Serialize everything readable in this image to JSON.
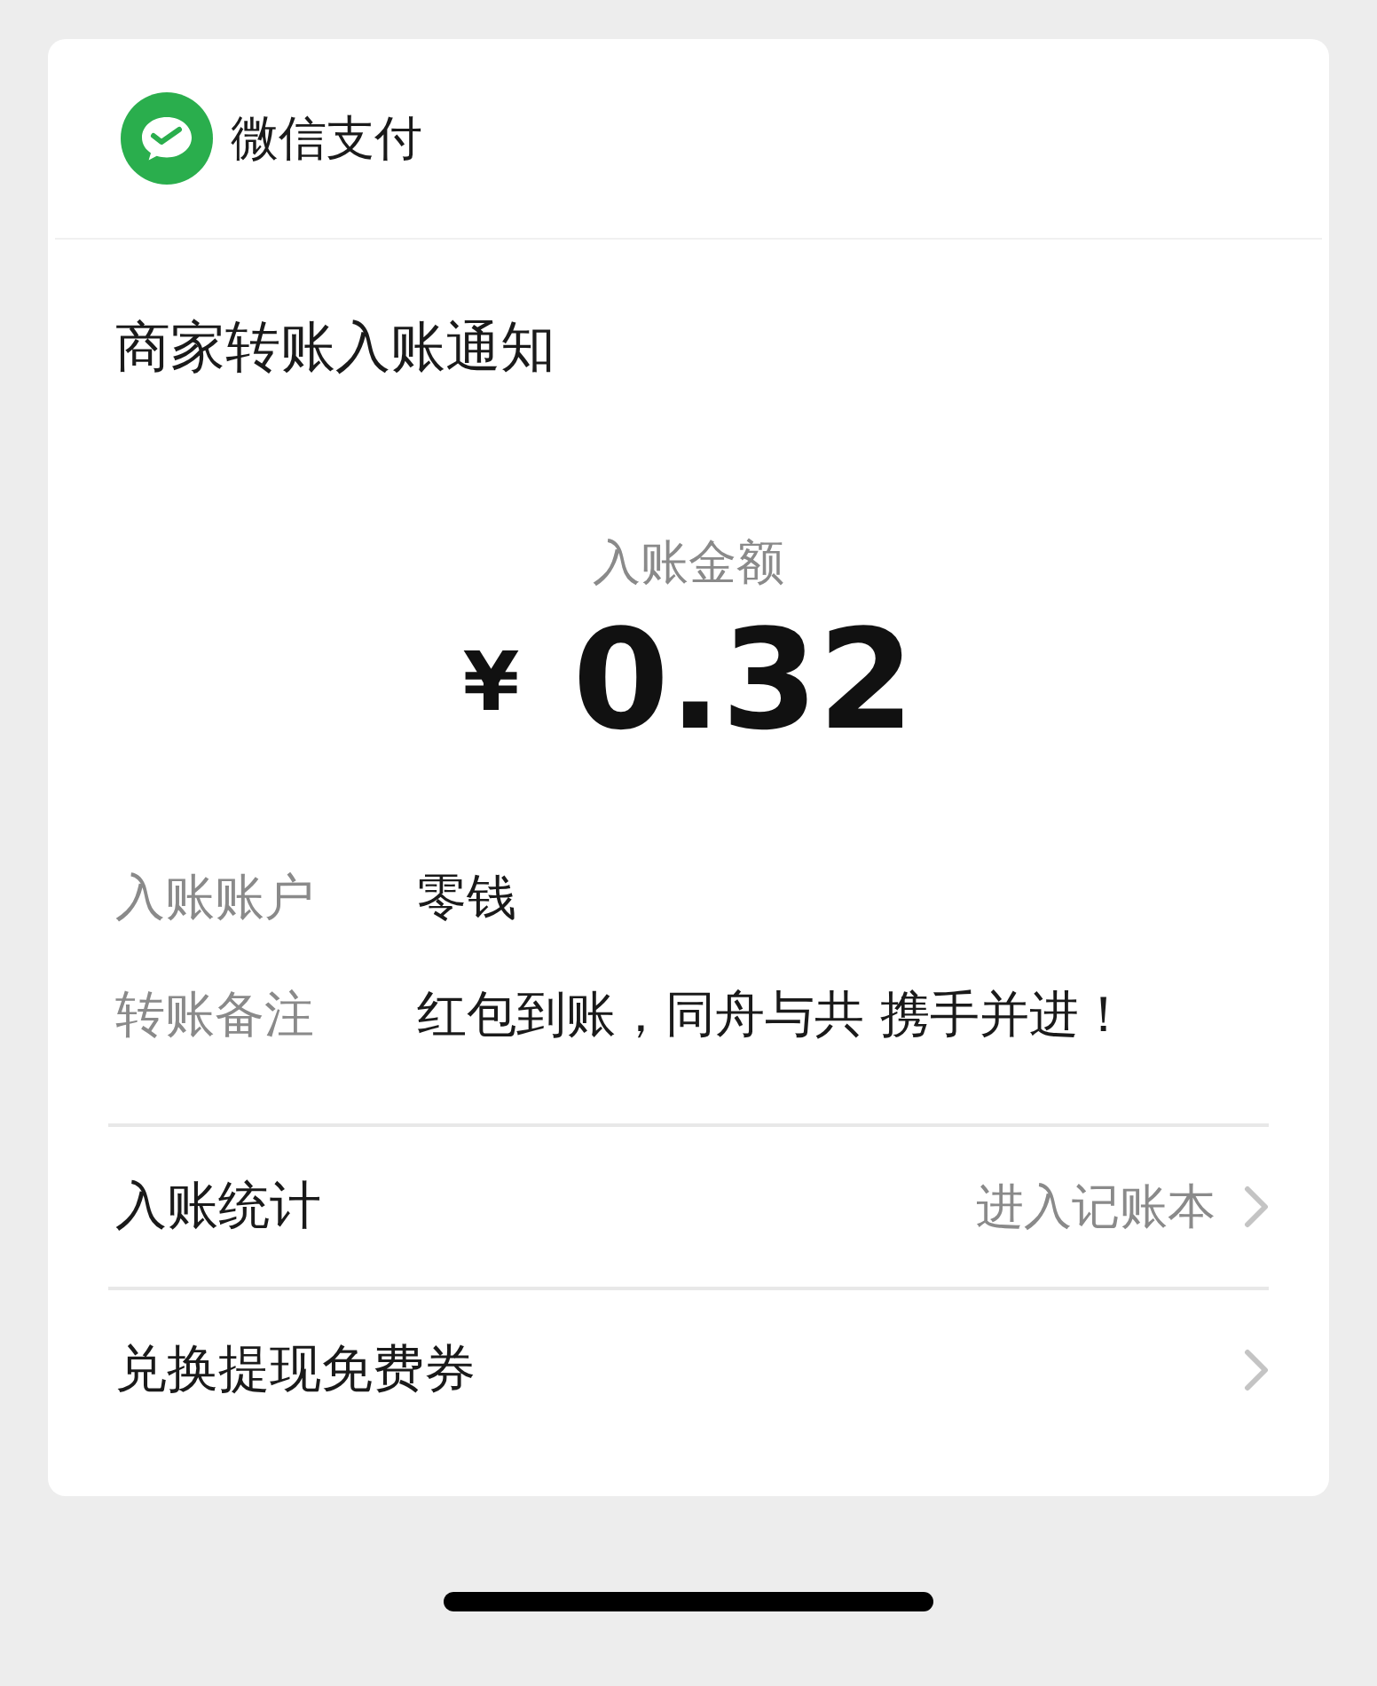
{
  "header": {
    "brand": "微信支付"
  },
  "title": "商家转账入账通知",
  "amount": {
    "label": "入账金额",
    "currency": "¥",
    "value": "0.32"
  },
  "details": [
    {
      "label": "入账账户",
      "value": "零钱"
    },
    {
      "label": "转账备注",
      "value": "红包到账，同舟与共 携手并进！"
    }
  ],
  "links": [
    {
      "label": "入账统计",
      "hint": "进入记账本"
    },
    {
      "label": "兑换提现免费券"
    }
  ]
}
